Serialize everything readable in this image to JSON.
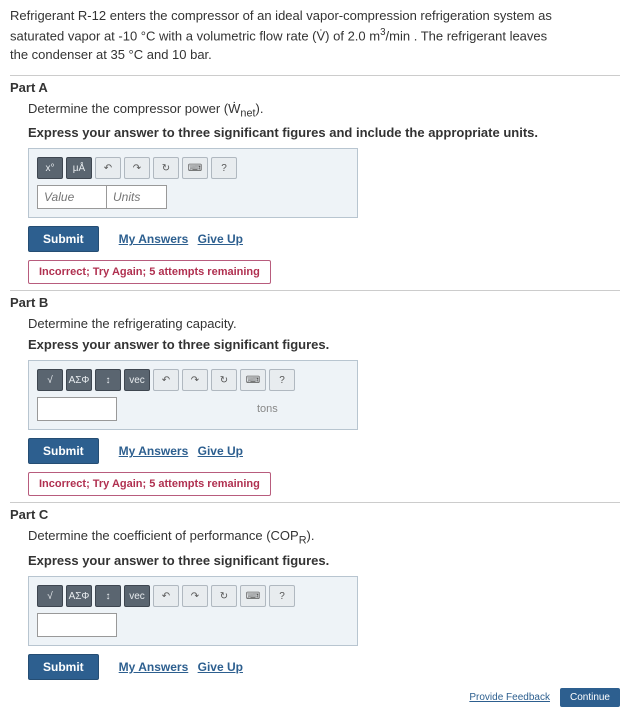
{
  "problem": {
    "line1_a": "Refrigerant R-12 enters the compressor of an ideal vapor-compression refrigeration system as",
    "line2_a": "saturated vapor at -10 °C with a volumetric flow rate (",
    "line2_b": ") of 2.0 m",
    "line2_c": "/min . The refrigerant leaves",
    "line3": "the condenser at 35 °C and 10 bar.",
    "vdot": "V̇",
    "sup3": "3"
  },
  "common": {
    "submit": "Submit",
    "my_answers": "My Answers",
    "give_up": "Give Up",
    "value_ph": "Value",
    "units_ph": "Units",
    "feedback": "Incorrect; Try Again; 5 attempts remaining",
    "provide_feedback": "Provide Feedback",
    "continue": "Continue"
  },
  "toolbar": {
    "t1": "x°",
    "t2": "μÅ",
    "undo": "↶",
    "redo": "↷",
    "reset": "↻",
    "kb": "⌨",
    "help": "?",
    "sq": "√",
    "sig": "ΑΣΦ",
    "it": "↕",
    "vec": "vec"
  },
  "partA": {
    "title": "Part A",
    "prompt_a": "Determine the compressor power (",
    "prompt_b": ").",
    "wnet": "Ẇ",
    "wnet_sub": "net",
    "instr": "Express your answer to three significant figures and include the appropriate units."
  },
  "partB": {
    "title": "Part B",
    "prompt": "Determine the refrigerating capacity.",
    "instr": "Express your answer to three significant figures.",
    "unit": "tons"
  },
  "partC": {
    "title": "Part C",
    "prompt_a": "Determine the coefficient of performance (",
    "prompt_b": ").",
    "cop": "COP",
    "cop_sub": "R",
    "instr": "Express your answer to three significant figures."
  }
}
